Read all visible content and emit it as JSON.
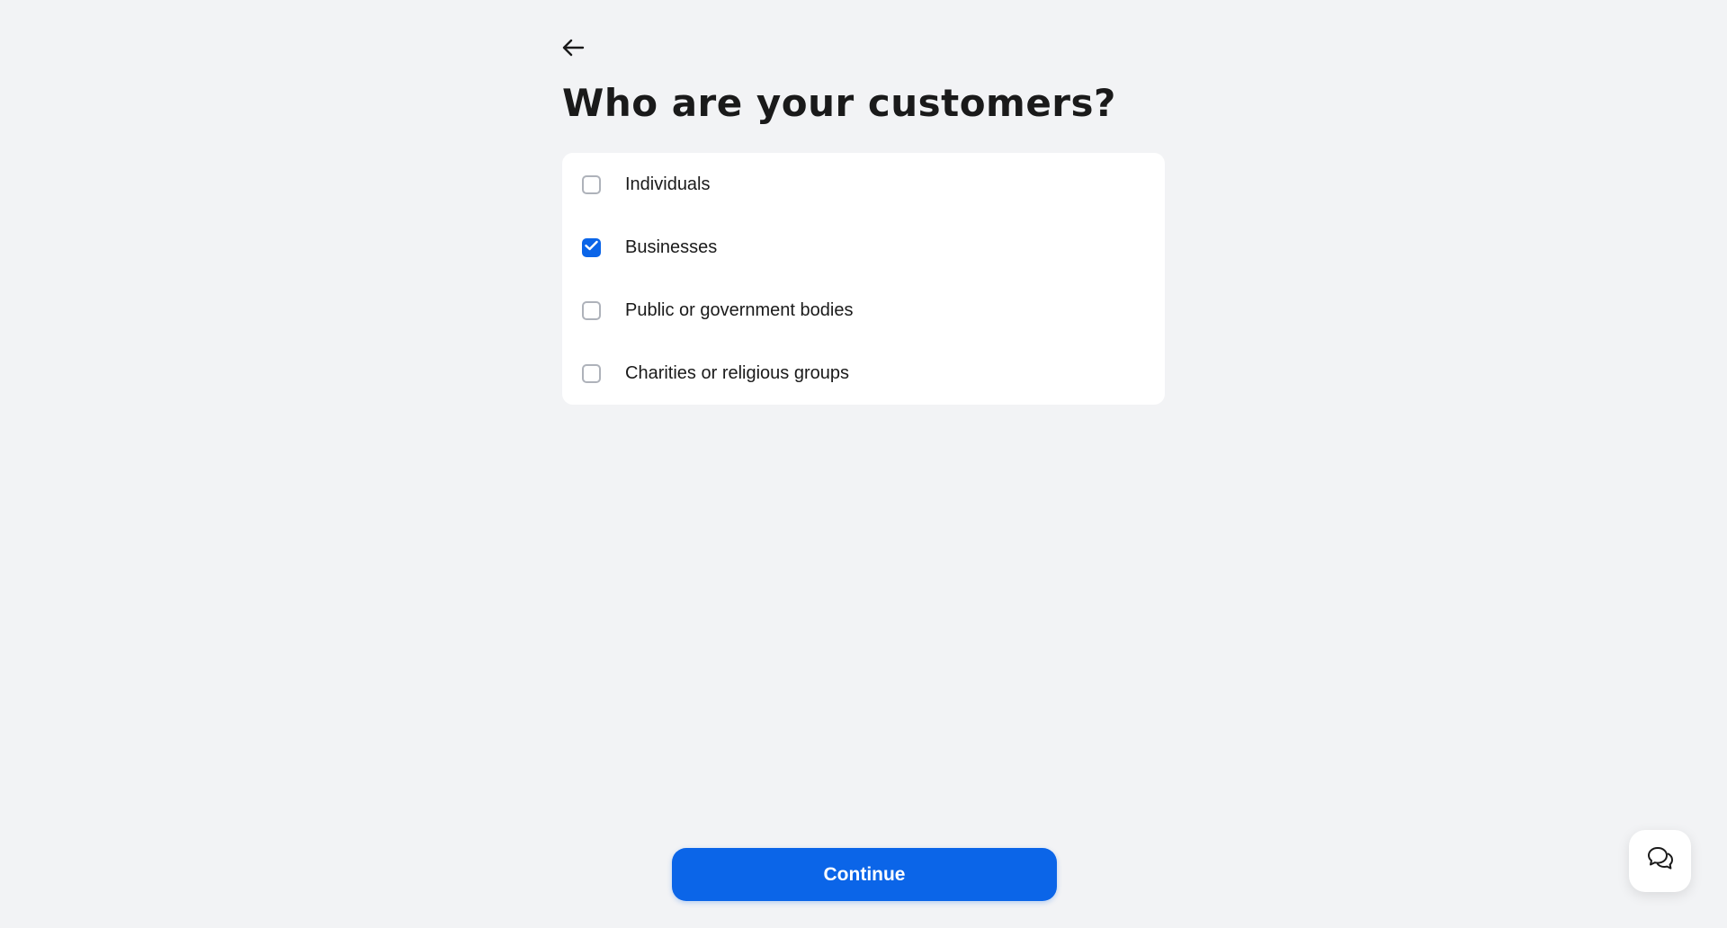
{
  "header": {
    "back_icon": "arrow-left-icon",
    "title": "Who are your customers?"
  },
  "options": [
    {
      "label": "Individuals",
      "checked": false
    },
    {
      "label": "Businesses",
      "checked": true
    },
    {
      "label": "Public or government bodies",
      "checked": false
    },
    {
      "label": "Charities or religious groups",
      "checked": false
    }
  ],
  "footer": {
    "continue_label": "Continue"
  },
  "chat": {
    "icon": "chat-bubbles-icon"
  },
  "colors": {
    "accent": "#0b65e8",
    "background": "#f2f3f5",
    "card": "#ffffff",
    "text": "#1a1a1a",
    "checkbox_border": "#aeb2ba"
  }
}
